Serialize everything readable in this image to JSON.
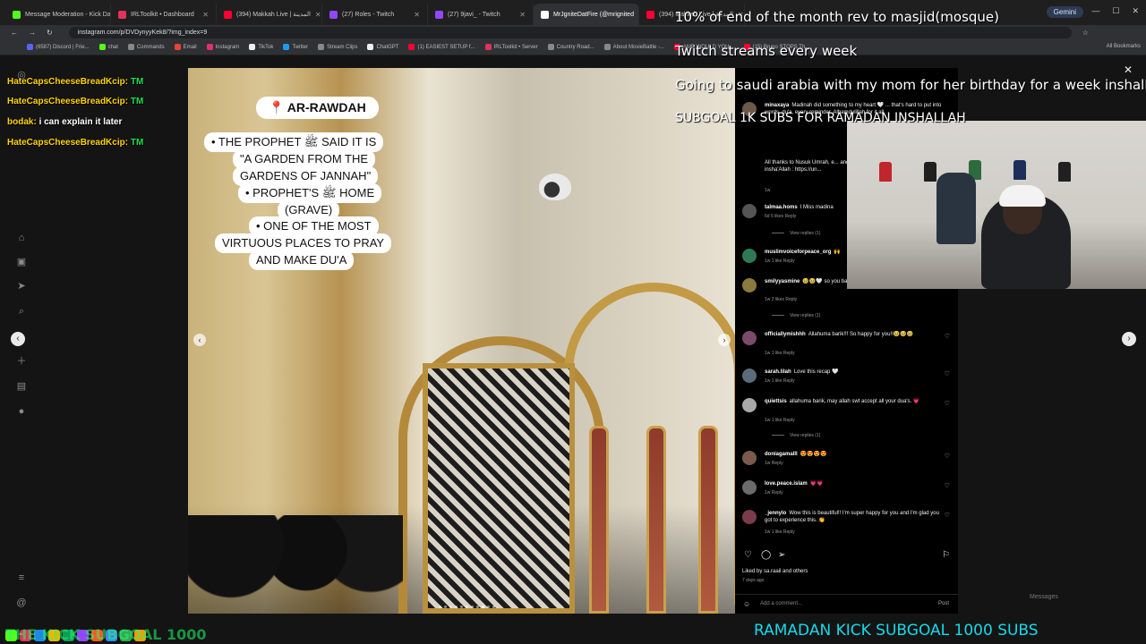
{
  "browser": {
    "tabs": [
      {
        "label": "Message Moderation - Kick Da",
        "color": "#53fc18"
      },
      {
        "label": "IRLToolkit • Dashboard",
        "color": "#e2335b"
      },
      {
        "label": "(394) Makkah Live | المدينة",
        "color": "#ff0033"
      },
      {
        "label": "(27) Roles - Twitch",
        "color": "#9146ff"
      },
      {
        "label": "(27) 9javi_ - Twitch",
        "color": "#9146ff"
      },
      {
        "label": "MrJgniteDatFire (@mrignited",
        "color": "#ffffff"
      },
      {
        "label": "(394) Makkah Live | المدينة",
        "color": "#ff0033"
      }
    ],
    "gemini_label": "Gemini",
    "url": "instagram.com/p/DVDynyyKek8/?img_index=9",
    "bookmarks": [
      {
        "label": "(6587) Discord | Frie...",
        "color": "#5865f2"
      },
      {
        "label": "chat",
        "color": "#53fc18"
      },
      {
        "label": "Commands",
        "color": "#888888"
      },
      {
        "label": "Email",
        "color": "#ea4335"
      },
      {
        "label": "Instagram",
        "color": "#e1306c"
      },
      {
        "label": "TikTok",
        "color": "#eeeeee"
      },
      {
        "label": "Twitter",
        "color": "#1d9bf0"
      },
      {
        "label": "Stream Clips",
        "color": "#888888"
      },
      {
        "label": "ChatGPT",
        "color": "#eeeeee"
      },
      {
        "label": "(1) EASIEST SETUP f...",
        "color": "#ff0033"
      },
      {
        "label": "IRLToolkit • Server",
        "color": "#e2335b"
      },
      {
        "label": "Country Road...",
        "color": "#888888"
      },
      {
        "label": "About MovieBattle -...",
        "color": "#888888"
      },
      {
        "label": "AMP WOULD YOU...",
        "color": "#ff0033"
      },
      {
        "label": "(15) Bruno STOPS Th...",
        "color": "#ff0033"
      }
    ],
    "all_bookmarks": "All Bookmarks"
  },
  "post": {
    "overlay_pin": "📍 AR-RAWDAH",
    "overlay_lines": [
      "• THE PROPHET ﷺ SAID IT IS",
      "\"A GARDEN FROM THE",
      "GARDENS OF JANNAH\"",
      "• PROPHET'S ﷺ HOME",
      "(GRAVE)",
      "• ONE OF THE MOST",
      "VIRTUOUS PLACES TO PRAY",
      "AND MAKE DU'A"
    ]
  },
  "comments": [
    {
      "user": "minaxaya",
      "text": "Madinah did something to my heart 🤍 ... that's hard to put into words. du'a, every reminder. Alhamdulillah for it all.",
      "meta": "",
      "avatar": "#6b5a4b"
    },
    {
      "user": "",
      "text": "All thanks to Nusuk Umrah, e... and seamless from start to fin... Umrah insha'Allah : https://un...",
      "meta": "1w",
      "avatar": ""
    },
    {
      "user": "talmaa.homs",
      "text": "I Miss madina",
      "meta": "6d  5 likes  Reply",
      "avatar": "#555555"
    },
    {
      "user": "muslimvoiceforpeace_org",
      "text": "🙌",
      "meta": "1w  1 like  Reply",
      "avatar": "#2f7a55"
    },
    {
      "user": "smilyyasmine",
      "text": "🥹🥹🤍 so you baby girl 🥹🤍",
      "meta": "1w  2 likes  Reply",
      "avatar": "#8a7a3d"
    },
    {
      "user": "officiallymishhh",
      "text": "Allahuma barik!!! So happy for you!!🥹🥹🥹",
      "meta": "1w  1 like  Reply",
      "avatar": "#7a4b6b"
    },
    {
      "user": "sarah.lilah",
      "text": "Love this recap 🤍",
      "meta": "1w  1 like  Reply",
      "avatar": "#5b6b7a"
    },
    {
      "user": "quiettsis",
      "text": "allahuma barik, may allah swt accept all your dua's. 💗",
      "meta": "1w  1 like  Reply",
      "avatar": "#a8a8a8"
    },
    {
      "user": "doniagamalll",
      "text": "😍😍😍😍",
      "meta": "1w  Reply",
      "avatar": "#7a5b4b"
    },
    {
      "user": "love.peace.islam",
      "text": "💗💗",
      "meta": "1w  Reply",
      "avatar": "#6b6b6b"
    },
    {
      "user": "_jennylo",
      "text": "Wow this is beautiful!! I'm super happy for you and I'm glad you got to experience this. 👏",
      "meta": "1w  1 like  Reply",
      "avatar": "#7a3b4b"
    }
  ],
  "view_replies": [
    "View replies (1)",
    "View replies (1)",
    "View replies (1)"
  ],
  "liked_by": "Liked by sa.raail and others",
  "time_ago": "7 days ago",
  "add_comment_placeholder": "Add a comment...",
  "post_button": "Post",
  "messages_label": "Messages",
  "stream_overlay": {
    "goals": [
      "10% of end of the month rev to masjid(mosque)",
      "Twitch streams every week",
      "Going to saudi arabia with my mom for her birthday for a week inshallah",
      "SUBGOAL 1K SUBS FOR RAMADAN INSHALLAH"
    ],
    "chat": [
      {
        "user": "HateCapsCheeseBreadKcip:",
        "msg": "TM"
      },
      {
        "user": "HateCapsCheeseBreadKcip:",
        "msg": "TM"
      },
      {
        "user": "bodak:",
        "msg": "i can explain it later"
      },
      {
        "user": "HateCapsCheeseBreadKcip:",
        "msg": "TM"
      }
    ],
    "ticker": "RAMADAN KICK SUBGOAL 1000 SUBS",
    "ghost_text": "THE KICK SUBGOAL 1000"
  }
}
